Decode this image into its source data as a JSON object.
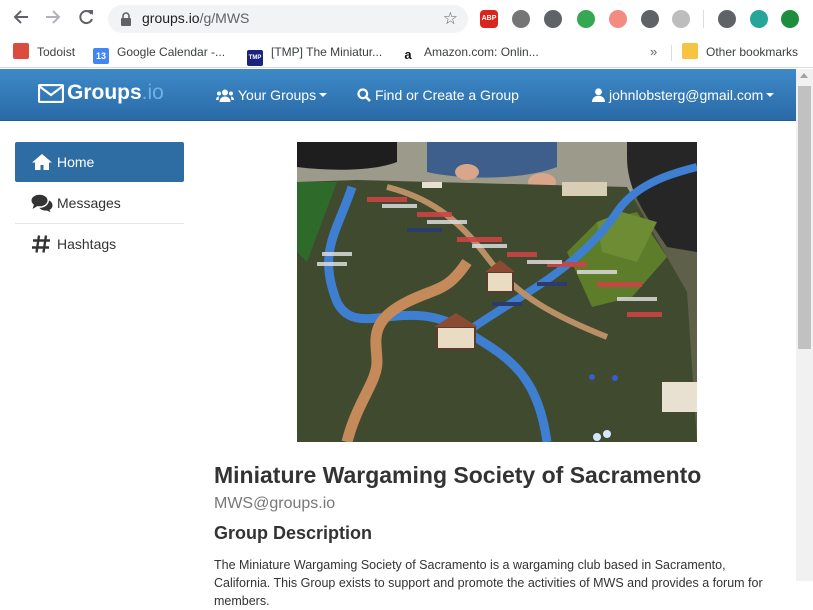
{
  "browser": {
    "url_host": "groups.io",
    "url_path": "/g/MWS",
    "bookmarks": [
      {
        "label": "Todoist",
        "icon": "todoist-icon"
      },
      {
        "label": "Google Calendar -...",
        "icon": "google-calendar-icon",
        "icon_text": "13"
      },
      {
        "label": "[TMP] The Miniatur...",
        "icon": "tmp-icon",
        "icon_text": "TMP"
      },
      {
        "label": "Amazon.com: Onlin...",
        "icon": "amazon-icon",
        "icon_text": "a"
      }
    ],
    "more_bookmarks": "»",
    "other_bookmarks": "Other bookmarks",
    "extensions": [
      {
        "name": "adblock-plus-icon",
        "text": "ABP",
        "color": "#d9251d"
      },
      {
        "name": "google-drive-icon",
        "color": "#757575"
      },
      {
        "name": "pocket-icon",
        "color": "#5f6368"
      },
      {
        "name": "sync-icon",
        "color": "#34a853"
      },
      {
        "name": "extension-pink-icon",
        "color": "#f28b82"
      },
      {
        "name": "extension-circle-icon",
        "color": "#5f6368"
      },
      {
        "name": "extension-gray-icon",
        "color": "#bdbdbd"
      },
      {
        "name": "cast-icon",
        "color": "#5f6368"
      },
      {
        "name": "extension-teal-icon",
        "color": "#26a69a"
      },
      {
        "name": "extension-green-icon",
        "color": "#1e8e3e"
      }
    ]
  },
  "navbar": {
    "logo_main": "Groups",
    "logo_suffix": ".io",
    "your_groups": "Your Groups",
    "find_create": "Find or Create a Group",
    "user_email": "johnlobsterg@gmail.com",
    "bg_color": "#2f75b5"
  },
  "sidebar": {
    "items": [
      {
        "label": "Home",
        "icon": "home-icon",
        "active": true
      },
      {
        "label": "Messages",
        "icon": "messages-icon",
        "active": false
      },
      {
        "label": "Hashtags",
        "icon": "hashtag-icon",
        "active": false
      }
    ]
  },
  "group": {
    "title": "Miniature Wargaming Society of Sacramento",
    "email": "MWS@groups.io",
    "description_heading": "Group Description",
    "description": "The Miniature Wargaming Society of Sacramento  is a wargaming club based in Sacramento, California. This Group exists to support and promote the activities of MWS and provides a forum for members."
  }
}
